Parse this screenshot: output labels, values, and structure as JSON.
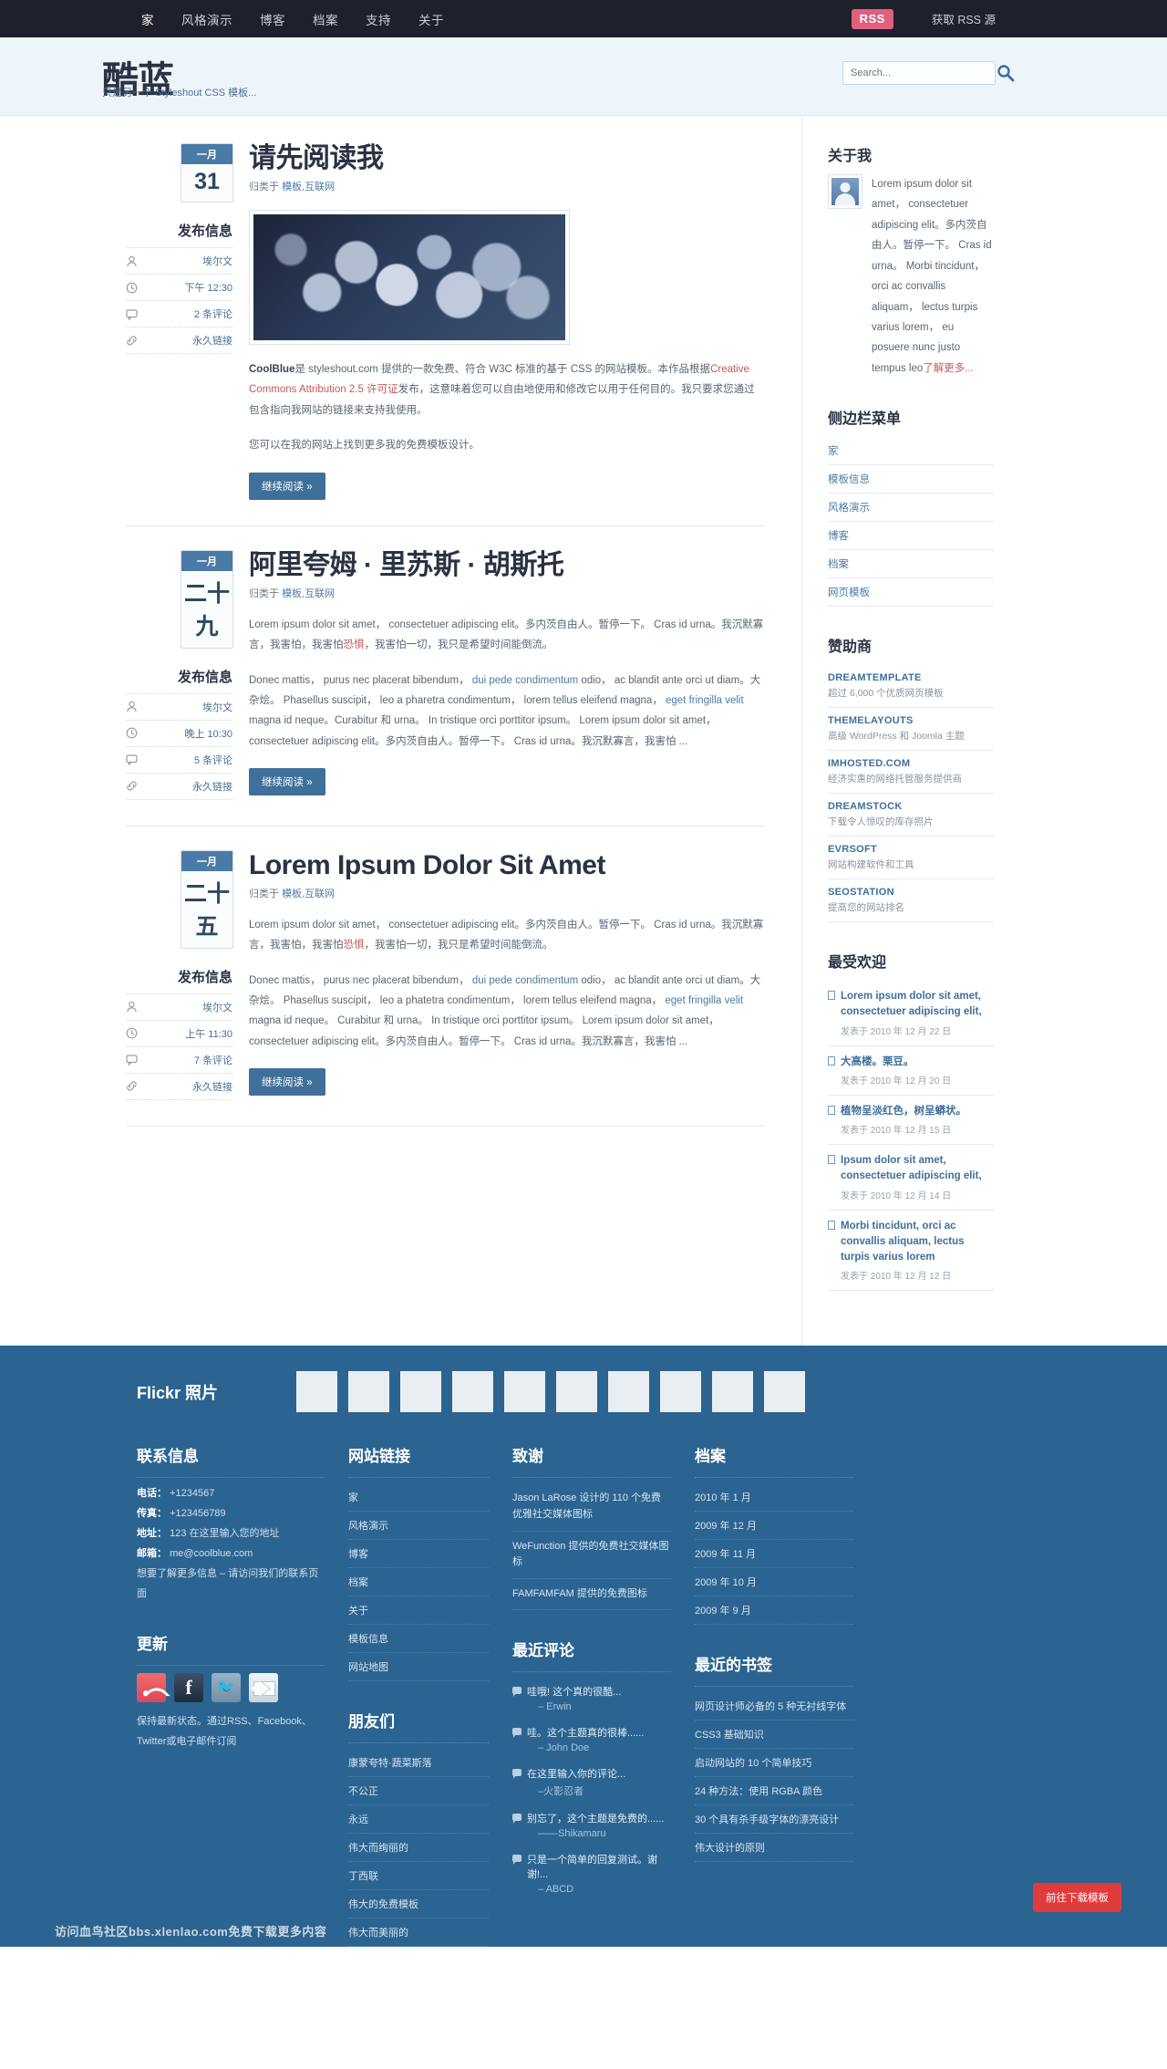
{
  "topnav": {
    "items": [
      {
        "label": "家",
        "active": true
      },
      {
        "label": "风格演示",
        "active": false
      },
      {
        "label": "博客",
        "active": false
      },
      {
        "label": "档案",
        "active": false
      },
      {
        "label": "支持",
        "active": false
      },
      {
        "label": "关于",
        "active": false
      }
    ],
    "rss_badge": "RSS",
    "rss_text": "获取 RSS 源"
  },
  "header": {
    "logo": "酷蓝",
    "tagline": "只是另一个 Styleshout CSS 模板...",
    "search_placeholder": "Search...",
    "search_value": ""
  },
  "posts": [
    {
      "month": "一月",
      "day": "31",
      "title": "请先阅读我",
      "title_latin": false,
      "category_prefix": "归类于",
      "categories": [
        "模板",
        "互联网"
      ],
      "has_image": true,
      "meta_heading": "发布信息",
      "meta": [
        {
          "icon": "user-icon",
          "label": "埃尔文"
        },
        {
          "icon": "clock-icon",
          "label": "下午 12:30"
        },
        {
          "icon": "comment-icon",
          "label": "2 条评论"
        },
        {
          "icon": "link-icon",
          "label": "永久链接"
        }
      ],
      "paragraphs": [
        {
          "segments": [
            {
              "text": "CoolBlue",
              "style": "bold"
            },
            {
              "text": "是 styleshout.com 提供的一款免费、符合 W3C 标准的基于 CSS 的网站模板。本作品根据",
              "style": "normal"
            },
            {
              "text": "Creative Commons Attribution 2.5 许可证",
              "style": "red"
            },
            {
              "text": "发布，这意味着您可以自由地使用和修改它以用于任何目的。我只要求您通过包含指向我网站的链接来支持我使用。",
              "style": "normal"
            }
          ]
        },
        {
          "segments": [
            {
              "text": "您可以在我的网站上找到更多我的免费模板设计。",
              "style": "normal"
            }
          ]
        }
      ],
      "button": "继续阅读"
    },
    {
      "month": "一月",
      "day": "二十九",
      "title": "阿里夸姆 · 里苏斯 · 胡斯托",
      "title_latin": false,
      "category_prefix": "归类于",
      "categories": [
        "模板",
        "互联网"
      ],
      "has_image": false,
      "meta_heading": "发布信息",
      "meta": [
        {
          "icon": "user-icon",
          "label": "埃尔文"
        },
        {
          "icon": "clock-icon",
          "label": "晚上 10:30"
        },
        {
          "icon": "comment-icon",
          "label": "5 条评论"
        },
        {
          "icon": "link-icon",
          "label": "永久链接"
        }
      ],
      "paragraphs": [
        {
          "segments": [
            {
              "text": "Lorem ipsum dolor sit amet， consectetuer adipiscing elit。多内茨自由人。暂停一下。 Cras id urna。我沉默寡言，我害怕，我害怕",
              "style": "normal"
            },
            {
              "text": "恐惧",
              "style": "red"
            },
            {
              "text": "，我害怕一切，我只是希望时间能倒流。",
              "style": "normal"
            }
          ]
        },
        {
          "segments": [
            {
              "text": "Donec mattis， purus nec placerat bibendum， ",
              "style": "normal"
            },
            {
              "text": "dui pede condimentum",
              "style": "link"
            },
            {
              "text": " odio， ac blandit ante orci ut diam。大杂烩。 Phasellus suscipit， leo a pharetra condimentum， lorem tellus eleifend magna， ",
              "style": "normal"
            },
            {
              "text": "eget fringilla velit",
              "style": "link"
            },
            {
              "text": " magna id neque。Curabitur 和 urna。 In tristique orci porttitor ipsum。 Lorem ipsum dolor sit amet， consectetuer adipiscing elit。多内茨自由人。暂停一下。 Cras id urna。我沉默寡言，我害怕 ...",
              "style": "normal"
            }
          ]
        }
      ],
      "button": "继续阅读"
    },
    {
      "month": "一月",
      "day": "二十五",
      "title": "Lorem Ipsum Dolor Sit Amet",
      "title_latin": true,
      "category_prefix": "归类于",
      "categories": [
        "模板",
        "互联网"
      ],
      "has_image": false,
      "meta_heading": "发布信息",
      "meta": [
        {
          "icon": "user-icon",
          "label": "埃尔文"
        },
        {
          "icon": "clock-icon",
          "label": "上午 11:30"
        },
        {
          "icon": "comment-icon",
          "label": "7 条评论"
        },
        {
          "icon": "link-icon",
          "label": "永久链接"
        }
      ],
      "paragraphs": [
        {
          "segments": [
            {
              "text": "Lorem ipsum dolor sit amet， consectetuer adipiscing elit。多内茨自由人。暂停一下。 Cras id urna。我沉默寡言，我害怕，我害怕",
              "style": "normal"
            },
            {
              "text": "恐惧",
              "style": "red"
            },
            {
              "text": "，我害怕一切，我只是希望时间能倒流。",
              "style": "normal"
            }
          ]
        },
        {
          "segments": [
            {
              "text": "Donec mattis， purus nec placerat bibendum， ",
              "style": "normal"
            },
            {
              "text": "dui pede condimentum",
              "style": "link"
            },
            {
              "text": " odio， ac blandit ante orci ut diam。大杂烩。 Phasellus suscipit， leo a phatetra condimentum， lorem tellus eleifend magna， ",
              "style": "normal"
            },
            {
              "text": "eget fringilla velit",
              "style": "link"
            },
            {
              "text": " magna id neque。 Curabitur 和 urna。 In tristique orci porttitor ipsum。 Lorem ipsum dolor sit amet， consectetuer adipiscing elit。多内茨自由人。暂停一下。 Cras id urna。我沉默寡言，我害怕 ...",
              "style": "normal"
            }
          ]
        }
      ],
      "button": "继续阅读"
    }
  ],
  "sidebar": {
    "about": {
      "heading": "关于我",
      "text": "Lorem ipsum dolor sit amet， consectetuer adipiscing elit。多内茨自由人。暂停一下。 Cras id urna。 Morbi tincidunt， orci ac convallis aliquam， lectus turpis varius lorem， eu posuere nunc justo tempus leo",
      "more_link": "了解更多..."
    },
    "menu": {
      "heading": "侧边栏菜单",
      "items": [
        "家",
        "模板信息",
        "风格演示",
        "博客",
        "档案",
        "网页模板"
      ]
    },
    "sponsors": {
      "heading": "赞助商",
      "items": [
        {
          "name": "DREAMTEMPLATE",
          "desc": "超过 6,000 个优质网页模板"
        },
        {
          "name": "THEMELAYOUTS",
          "desc": "高级 WordPress 和 Joomla 主题"
        },
        {
          "name": "IMHOSTED.COM",
          "desc": "经济实惠的网络托管服务提供商"
        },
        {
          "name": "DREAMSTOCK",
          "desc": "下载令人惊叹的库存照片"
        },
        {
          "name": "EVRSOFT",
          "desc": "网站构建软件和工具"
        },
        {
          "name": "SEOSTATION",
          "desc": "提高您的网站排名"
        }
      ]
    },
    "popular": {
      "heading": "最受欢迎",
      "items": [
        {
          "title": "Lorem ipsum dolor sit amet, consectetuer adipiscing elit,",
          "date": "发表于 2010 年 12 月 22 日"
        },
        {
          "title": "大高楼。栗豆。",
          "date": "发表于 2010 年 12 月 20 日"
        },
        {
          "title": "植物呈淡红色，树呈蟒状。",
          "date": "发表于 2010 年 12 月 15 日"
        },
        {
          "title": "Ipsum dolor sit amet, consectetuer adipiscing elit,",
          "date": "发表于 2010 年 12 月 14 日"
        },
        {
          "title": "Morbi tincidunt, orci ac convallis aliquam, lectus turpis varius lorem",
          "date": "发表于 2010 年 12 月 12 日"
        }
      ]
    }
  },
  "footer": {
    "flickr_heading": "Flickr 照片",
    "flickr_count": 10,
    "contact": {
      "heading": "联系信息",
      "phone_label": "电话：",
      "phone": "+1234567",
      "fax_label": "传真：",
      "fax": "+123456789",
      "address_label": "地址：",
      "address": "123 在这里输入您的地址",
      "email_label": "邮箱：",
      "email": "me@coolblue.com",
      "note": "想要了解更多信息 – 请访问我们的联系页面"
    },
    "updates": {
      "heading": "更新",
      "icons": [
        "rss-icon",
        "facebook-icon",
        "twitter-icon",
        "email-icon"
      ],
      "note": "保持最新状态。通过RSS、Facebook、Twitter或电子邮件订阅"
    },
    "sitelinks": {
      "heading": "网站链接",
      "items": [
        "家",
        "风格演示",
        "博客",
        "档案",
        "关于",
        "模板信息",
        "网站地图"
      ]
    },
    "friends": {
      "heading": "朋友们",
      "items": [
        "康蒙夸特·蔬菜斯落",
        "不公正",
        "永远",
        "伟大而绚丽的",
        "丁西联",
        "伟大的免费模板",
        "伟大而美丽的"
      ]
    },
    "credits": {
      "heading": "致谢",
      "items": [
        "Jason LaRose 设计的 110 个免费优雅社交媒体图标",
        "WeFunction 提供的免费社交媒体图标",
        "FAMFAMFAM 提供的免费图标"
      ]
    },
    "recent_comments": {
      "heading": "最近评论",
      "items": [
        {
          "text": "哇哦! 这个真的很酷...",
          "author": "– Erwin"
        },
        {
          "text": "哇。这个主题真的很棒......",
          "author": "– John Doe"
        },
        {
          "text": "在这里输入你的评论...",
          "author": "–火影忍者"
        },
        {
          "text": "别忘了，这个主题是免费的......",
          "author": "——Shikamaru"
        },
        {
          "text": "只是一个简单的回复测试。谢谢!...",
          "author": "– ABCD"
        }
      ]
    },
    "archives": {
      "heading": "档案",
      "items": [
        "2010 年 1 月",
        "2009 年 12 月",
        "2009 年 11 月",
        "2009 年 10 月",
        "2009 年 9 月"
      ]
    },
    "bookmarks": {
      "heading": "最近的书签",
      "items": [
        "网页设计师必备的 5 种无衬线字体",
        "CSS3 基础知识",
        "启动网站的 10 个简单技巧",
        "24 种方法：使用 RGBA 颜色",
        "30 个具有杀手级字体的漂亮设计",
        "伟大设计的原则"
      ]
    },
    "download_button": "前往下载模板",
    "bottom_note": "访问血鸟社区bbs.xlenlao.com免费下载更多内容",
    "accent": "#2b6491"
  }
}
